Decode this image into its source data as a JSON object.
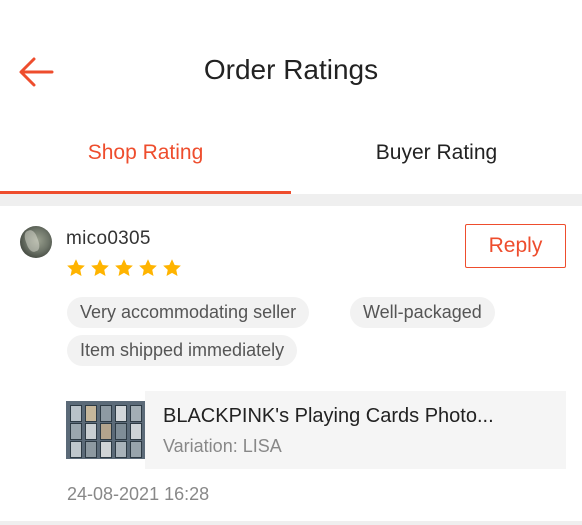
{
  "header": {
    "title": "Order Ratings",
    "back_icon": "arrow-left-icon"
  },
  "tabs": [
    {
      "label": "Shop Rating",
      "active": true
    },
    {
      "label": "Buyer Rating",
      "active": false
    }
  ],
  "colors": {
    "accent": "#ee4d2d",
    "star": "#ffb400"
  },
  "review": {
    "username": "mico0305",
    "stars": 5,
    "reply_label": "Reply",
    "tags": [
      "Very accommodating seller",
      "Well-packaged",
      "Item shipped immediately"
    ],
    "product": {
      "name": "BLACKPINK's Playing Cards Photo...",
      "variation": "Variation: LISA"
    },
    "timestamp": "24-08-2021 16:28"
  }
}
